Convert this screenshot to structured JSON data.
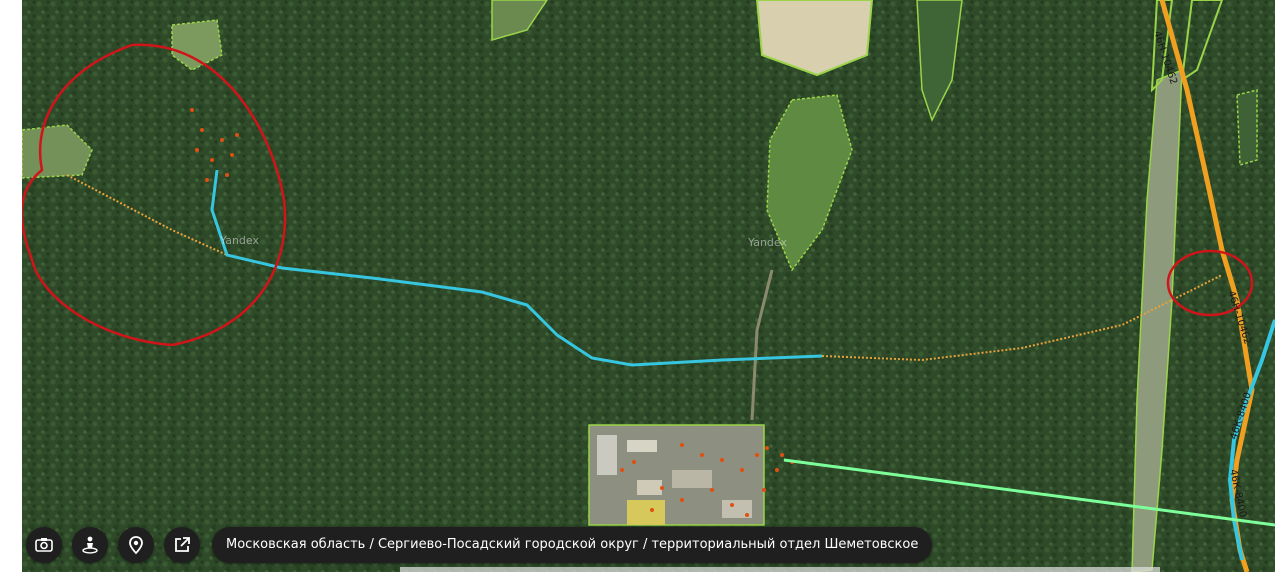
{
  "map": {
    "breadcrumb": "Московская область / Сергиево-Посадский городской округ / территориальный отдел Шеметовское",
    "watermark": "Yandex",
    "road_labels": {
      "top": "46Н-10462",
      "middle": "46Н-10462",
      "lower": "46К-8400",
      "bottom": "46К-8400"
    },
    "colors": {
      "forest": "#2f4a2a",
      "field": "#7f9b5a",
      "track_cyan": "#37c6e0",
      "track_orange": "#e8a23a",
      "route_green": "#7dff9a",
      "annotation_red": "#d1141a",
      "boundary_green": "#8fd13a",
      "highway_orange": "#f0a020"
    }
  },
  "controls": [
    {
      "name": "screenshot-button",
      "icon": "camera-icon"
    },
    {
      "name": "panorama-button",
      "icon": "pegman-icon"
    },
    {
      "name": "place-button",
      "icon": "map-pin-icon"
    },
    {
      "name": "open-external-button",
      "icon": "external-link-icon"
    }
  ]
}
